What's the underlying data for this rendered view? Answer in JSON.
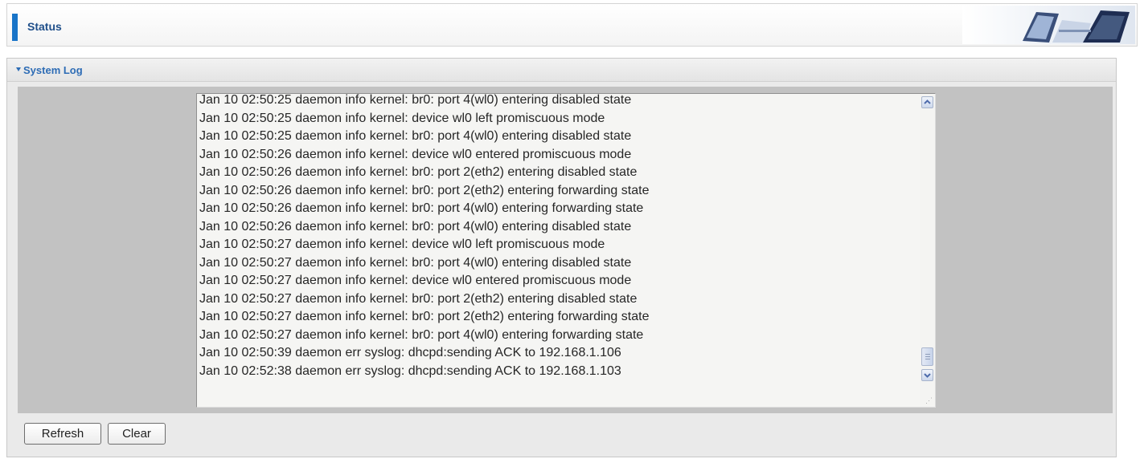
{
  "header": {
    "title": "Status",
    "art_icon": "network-devices-banner"
  },
  "section": {
    "title": "System Log",
    "caret_icon": "caret-down-icon"
  },
  "log": {
    "lines": [
      "Jan 10 02:50:25 daemon info kernel: br0: port 4(wl0) entering disabled state",
      "Jan 10 02:50:25 daemon info kernel: device wl0 left promiscuous mode",
      "Jan 10 02:50:25 daemon info kernel: br0: port 4(wl0) entering disabled state",
      "Jan 10 02:50:26 daemon info kernel: device wl0 entered promiscuous mode",
      "Jan 10 02:50:26 daemon info kernel: br0: port 2(eth2) entering disabled state",
      "Jan 10 02:50:26 daemon info kernel: br0: port 2(eth2) entering forwarding state",
      "Jan 10 02:50:26 daemon info kernel: br0: port 4(wl0) entering forwarding state",
      "Jan 10 02:50:26 daemon info kernel: br0: port 4(wl0) entering disabled state",
      "Jan 10 02:50:27 daemon info kernel: device wl0 left promiscuous mode",
      "Jan 10 02:50:27 daemon info kernel: br0: port 4(wl0) entering disabled state",
      "Jan 10 02:50:27 daemon info kernel: device wl0 entered promiscuous mode",
      "Jan 10 02:50:27 daemon info kernel: br0: port 2(eth2) entering disabled state",
      "Jan 10 02:50:27 daemon info kernel: br0: port 2(eth2) entering forwarding state",
      "Jan 10 02:50:27 daemon info kernel: br0: port 4(wl0) entering forwarding state",
      "Jan 10 02:50:39 daemon err syslog: dhcpd:sending ACK to 192.168.1.106",
      "Jan 10 02:52:38 daemon err syslog: dhcpd:sending ACK to 192.168.1.103"
    ],
    "scroll_position": 1.0
  },
  "buttons": {
    "refresh_label": "Refresh",
    "clear_label": "Clear"
  },
  "colors": {
    "accent": "#1874c8",
    "section_title": "#2d6cb5",
    "log_background": "#f5f5f3"
  }
}
